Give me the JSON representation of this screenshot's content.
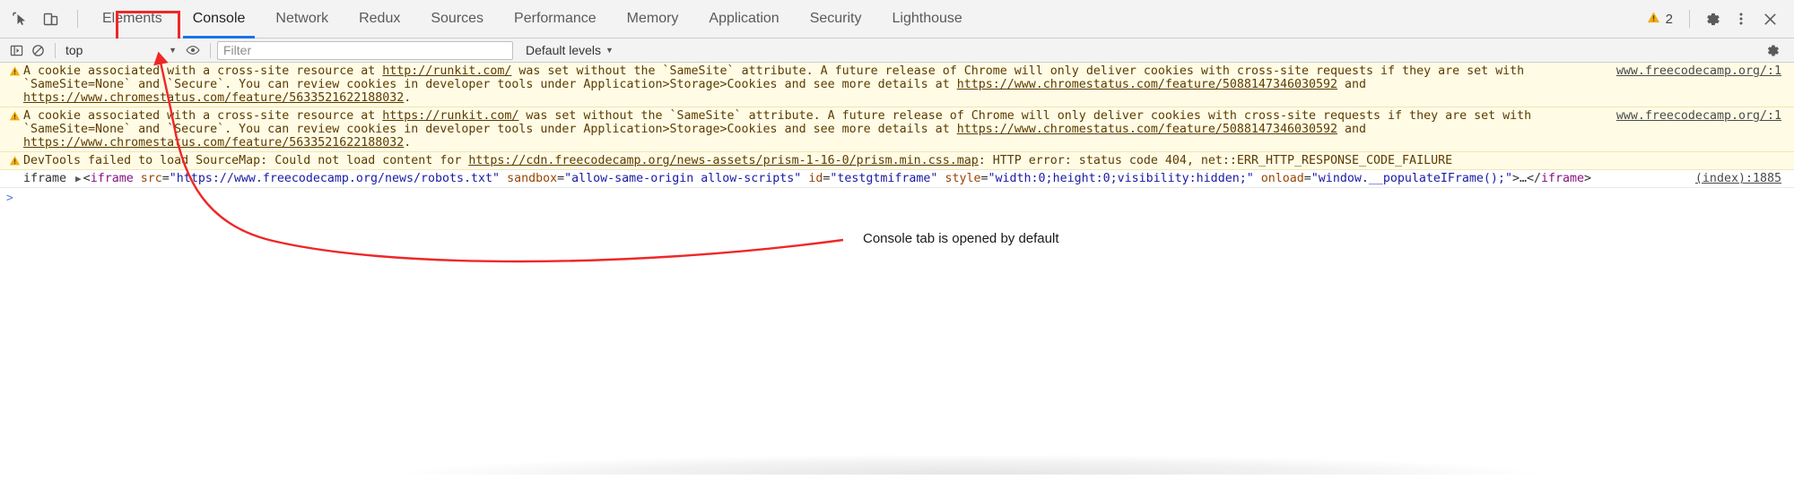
{
  "tabbar": {
    "left_icons": [
      {
        "name": "inspect-element-icon",
        "title": "Inspect element"
      },
      {
        "name": "device-toolbar-icon",
        "title": "Toggle device toolbar"
      }
    ],
    "tabs": [
      {
        "label": "Elements",
        "active": false
      },
      {
        "label": "Console",
        "active": true
      },
      {
        "label": "Network",
        "active": false
      },
      {
        "label": "Redux",
        "active": false
      },
      {
        "label": "Sources",
        "active": false
      },
      {
        "label": "Performance",
        "active": false
      },
      {
        "label": "Memory",
        "active": false
      },
      {
        "label": "Application",
        "active": false
      },
      {
        "label": "Security",
        "active": false
      },
      {
        "label": "Lighthouse",
        "active": false
      }
    ],
    "warning_count": "2",
    "right_icons": [
      {
        "name": "settings-gear-icon"
      },
      {
        "name": "more-options-kebab-icon"
      },
      {
        "name": "close-devtools-icon"
      }
    ]
  },
  "filterbar": {
    "sidebar_toggle": "console-sidebar-toggle-icon",
    "clear_console": "clear-console-icon",
    "context_value": "top",
    "live_expression": "eye-icon",
    "filter_placeholder": "Filter",
    "filter_value": "",
    "levels_label": "Default levels",
    "settings_icon": "console-settings-gear-icon"
  },
  "messages": [
    {
      "type": "warning",
      "icon": "warning-triangle-icon",
      "parts": [
        {
          "t": "text",
          "v": "A cookie associated with a cross-site resource at "
        },
        {
          "t": "link",
          "v": "http://runkit.com/"
        },
        {
          "t": "text",
          "v": " was set without the `SameSite` attribute. A future release of Chrome will only deliver cookies with cross-site requests if they are set with `SameSite=None` and `Secure`. You can review cookies in developer tools under Application>Storage>Cookies and see more details at "
        },
        {
          "t": "link",
          "v": "https://www.chromestatus.com/feature/5088147346030592"
        },
        {
          "t": "text",
          "v": " and "
        },
        {
          "t": "link",
          "v": "https://www.chromestatus.com/feature/5633521622188032"
        },
        {
          "t": "text",
          "v": "."
        }
      ],
      "source": "www.freecodecamp.org/:1"
    },
    {
      "type": "warning",
      "icon": "warning-triangle-icon",
      "parts": [
        {
          "t": "text",
          "v": "A cookie associated with a cross-site resource at "
        },
        {
          "t": "link",
          "v": "https://runkit.com/"
        },
        {
          "t": "text",
          "v": " was set without the `SameSite` attribute. A future release of Chrome will only deliver cookies with cross-site requests if they are set with `SameSite=None` and `Secure`. You can review cookies in developer tools under Application>Storage>Cookies and see more details at "
        },
        {
          "t": "link",
          "v": "https://www.chromestatus.com/feature/5088147346030592"
        },
        {
          "t": "text",
          "v": " and "
        },
        {
          "t": "link",
          "v": "https://www.chromestatus.com/feature/5633521622188032"
        },
        {
          "t": "text",
          "v": "."
        }
      ],
      "source": "www.freecodecamp.org/:1"
    },
    {
      "type": "warning",
      "icon": "warning-triangle-icon",
      "parts": [
        {
          "t": "text",
          "v": "DevTools failed to load SourceMap: Could not load content for "
        },
        {
          "t": "link",
          "v": "https://cdn.freecodecamp.org/news-assets/prism-1-16-0/prism.min.css.map"
        },
        {
          "t": "text",
          "v": ": HTTP error: status code 404, net::ERR_HTTP_RESPONSE_CODE_FAILURE"
        }
      ],
      "source": ""
    }
  ],
  "log_row": {
    "label": "iframe",
    "disclosure": "▶",
    "tokens": [
      {
        "cls": "punc",
        "v": "<"
      },
      {
        "cls": "tag",
        "v": "iframe"
      },
      {
        "cls": "punc",
        "v": " "
      },
      {
        "cls": "attr",
        "v": "src"
      },
      {
        "cls": "punc",
        "v": "="
      },
      {
        "cls": "val",
        "v": "\"https://www.freecodecamp.org/news/robots.txt\""
      },
      {
        "cls": "punc",
        "v": " "
      },
      {
        "cls": "attr",
        "v": "sandbox"
      },
      {
        "cls": "punc",
        "v": "="
      },
      {
        "cls": "val",
        "v": "\"allow-same-origin allow-scripts\""
      },
      {
        "cls": "punc",
        "v": " "
      },
      {
        "cls": "attr",
        "v": "id"
      },
      {
        "cls": "punc",
        "v": "="
      },
      {
        "cls": "val",
        "v": "\"testgtmiframe\""
      },
      {
        "cls": "punc",
        "v": " "
      },
      {
        "cls": "attr",
        "v": "style"
      },
      {
        "cls": "punc",
        "v": "="
      },
      {
        "cls": "val",
        "v": "\"width:0;height:0;visibility:hidden;\""
      },
      {
        "cls": "punc",
        "v": " "
      },
      {
        "cls": "attr",
        "v": "onload"
      },
      {
        "cls": "punc",
        "v": "="
      },
      {
        "cls": "val",
        "v": "\"window.__populateIFrame();\""
      },
      {
        "cls": "punc",
        "v": ">"
      },
      {
        "cls": "ellip",
        "v": "…"
      },
      {
        "cls": "punc",
        "v": "</"
      },
      {
        "cls": "tag",
        "v": "iframe"
      },
      {
        "cls": "punc",
        "v": ">"
      }
    ],
    "source": "(index):1885"
  },
  "prompt": {
    "caret": ">",
    "value": ""
  },
  "annotation": {
    "caption": "Console tab is opened by default",
    "color": "#ef2727"
  }
}
